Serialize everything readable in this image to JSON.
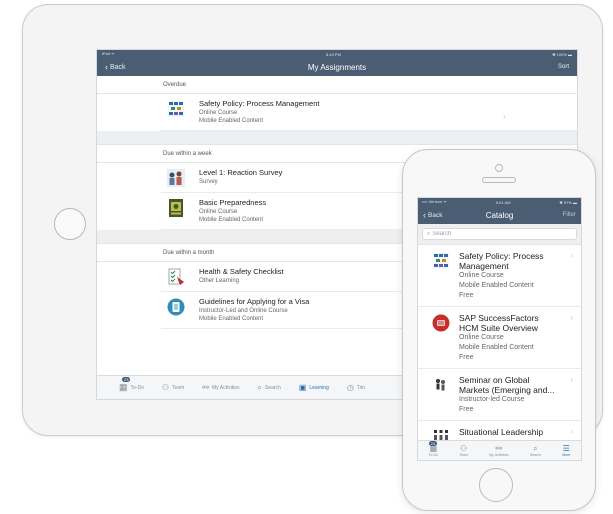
{
  "ipad": {
    "status": {
      "left": "iPad ᯤ",
      "time": "8:43 PM",
      "right": "✱ 100% ▬"
    },
    "nav": {
      "back": "Back",
      "title": "My Assignments",
      "action": "Sort"
    },
    "sections": [
      {
        "header": "Overdue",
        "items": [
          {
            "title": "Safety Policy: Process Management",
            "lines": [
              "Online Course",
              "Mobile Enabled Content"
            ]
          }
        ]
      },
      {
        "header": "Due within a week",
        "items": [
          {
            "title": "Level 1: Reaction Survey",
            "lines": [
              "Survey"
            ]
          },
          {
            "title": "Basic Preparedness",
            "lines": [
              "Online Course",
              "Mobile Enabled Content"
            ]
          }
        ]
      },
      {
        "header": "Due within a month",
        "items": [
          {
            "title": "Health & Safety Checklist",
            "lines": [
              "Other Learning"
            ]
          },
          {
            "title": "Guidelines for Applying for a Visa",
            "lines": [
              "Instructor-Led and Online Course",
              "Mobile Enabled Content"
            ]
          }
        ]
      }
    ],
    "tabs": [
      {
        "label": "To-Do",
        "badge": "23"
      },
      {
        "label": "Team"
      },
      {
        "label": "My Activities"
      },
      {
        "label": "Search"
      },
      {
        "label": "Learning"
      },
      {
        "label": "Tim"
      }
    ]
  },
  "iphone": {
    "status": {
      "left": "•••• Verizon ᯤ",
      "time": "9:01 AM",
      "right": "✱ 97% ▬"
    },
    "nav": {
      "back": "Back",
      "title": "Catalog",
      "action": "Filter"
    },
    "search": {
      "placeholder": "Search"
    },
    "items": [
      {
        "title": "Safety Policy: Process Management",
        "lines": [
          "Online Course",
          "Mobile Enabled Content",
          "Free"
        ]
      },
      {
        "title": "SAP SuccessFactors HCM Suite Overview",
        "lines": [
          "Online Course",
          "Mobile Enabled Content",
          "Free"
        ]
      },
      {
        "title": "Seminar on Global Markets (Emerging and...",
        "lines": [
          "Instructor-led Course",
          "Free"
        ]
      },
      {
        "title": "Situational Leadership",
        "lines": []
      }
    ],
    "tabs": [
      {
        "label": "To-Do",
        "badge": "24"
      },
      {
        "label": "Team"
      },
      {
        "label": "My Activities"
      },
      {
        "label": "Search"
      },
      {
        "label": "More"
      }
    ]
  },
  "colors": {
    "nav_bar": "#4a5d73",
    "accent": "#2f6fb3"
  }
}
